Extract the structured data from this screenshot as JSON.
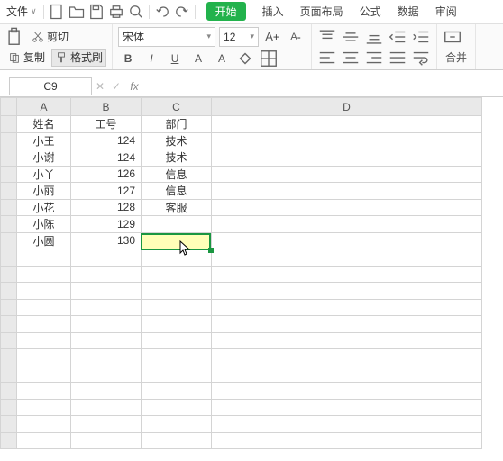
{
  "menubar": {
    "file": "文件"
  },
  "tabs": {
    "start": "开始",
    "insert": "插入",
    "layout": "页面布局",
    "formula": "公式",
    "data": "数据",
    "review": "审阅"
  },
  "clip": {
    "cut": "剪切",
    "copy": "复制",
    "painter": "格式刷"
  },
  "font": {
    "name": "宋体",
    "size": "12",
    "bold": "B",
    "italic": "I",
    "underline": "U"
  },
  "merge": {
    "label": "合并"
  },
  "namebox": {
    "ref": "C9"
  },
  "headers": {
    "A": "A",
    "B": "B",
    "C": "C",
    "D": "D"
  },
  "rows": [
    {
      "A": "姓名",
      "B": "工号",
      "C": "部门"
    },
    {
      "A": "小王",
      "B": "124",
      "C": "技术"
    },
    {
      "A": "小谢",
      "B": "124",
      "C": "技术"
    },
    {
      "A": "小丫",
      "B": "126",
      "C": "信息"
    },
    {
      "A": "小丽",
      "B": "127",
      "C": "信息"
    },
    {
      "A": "小花",
      "B": "128",
      "C": "客服"
    },
    {
      "A": "小陈",
      "B": "129",
      "C": ""
    },
    {
      "A": "小圆",
      "B": "130",
      "C": ""
    }
  ],
  "selected_cell": "C9"
}
